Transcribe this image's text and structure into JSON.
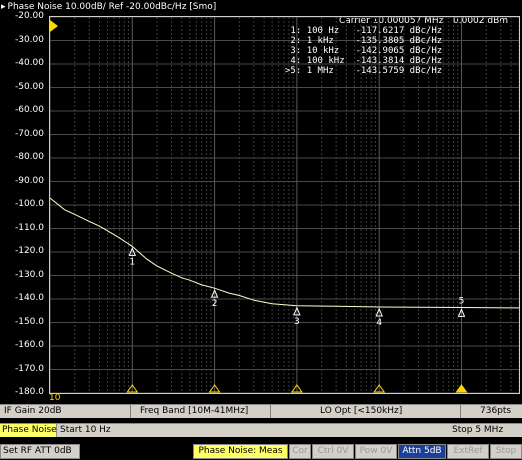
{
  "window_title": "Phase Noise 10.00dB/ Ref -20.00dBc/Hz [Smo]",
  "carrier": {
    "label": "Carrier 10.000057 MHz",
    "power": "0.0002 dBm"
  },
  "markers": [
    {
      "id": "1:",
      "freq": "100 Hz",
      "value": "-117.6217 dBc/Hz"
    },
    {
      "id": "2:",
      "freq": "1 kHz",
      "value": "-135.3805 dBc/Hz"
    },
    {
      "id": "3:",
      "freq": "10 kHz",
      "value": "-142.9065 dBc/Hz"
    },
    {
      "id": "4:",
      "freq": "100 kHz",
      "value": "-143.3814 dBc/Hz"
    },
    {
      "id": ">5:",
      "freq": "1 MHz",
      "value": "-143.5759 dBc/Hz"
    }
  ],
  "y_axis_labels": [
    "-20.00",
    "-30.00",
    "-40.00",
    "-50.00",
    "-60.00",
    "-70.00",
    "-80.00",
    "-90.00",
    "-100.0",
    "-110.0",
    "-120.0",
    "-130.0",
    "-140.0",
    "-150.0",
    "-160.0",
    "-170.0",
    "-180.0"
  ],
  "x_start_label": "10",
  "info_bar": {
    "if_gain": "IF Gain 20dB",
    "freq_band": "Freq Band [10M-41MHz]",
    "lo_opt": "LO Opt [<150kHz]",
    "points": "736pts"
  },
  "sweep_bar": {
    "mode": "Phase Noise",
    "start": "Start 10 Hz",
    "stop": "Stop 5 MHz"
  },
  "softkeys": {
    "set_rf_att": "Set RF ATT 0dB",
    "phase_noise_meas": "Phase Noise: Meas",
    "cor": "Cor",
    "ctrl": "Ctrl 0V",
    "pow": "Pow 0V",
    "attn": "Attn 5dB",
    "extref": "ExtRef",
    "stop": "Stop"
  },
  "chart_data": {
    "type": "line",
    "xscale": "log",
    "xlim": [
      10,
      5000000
    ],
    "ylim": [
      -180,
      -20
    ],
    "ylabel_unit": "dBc/Hz",
    "grid": true,
    "series": [
      {
        "x": [
          10,
          15,
          20,
          30,
          40,
          50,
          70,
          100,
          150,
          200,
          300,
          400,
          500,
          700,
          1000,
          1500,
          2000,
          3000,
          5000,
          10000,
          30000,
          100000,
          300000,
          1000000,
          5000000
        ],
        "y": [
          -97,
          -102,
          -104,
          -107,
          -109,
          -111,
          -114,
          -117.6,
          -123,
          -126,
          -129,
          -131,
          -132,
          -134,
          -135.4,
          -137.5,
          -138.5,
          -140.5,
          -142,
          -142.9,
          -143.1,
          -143.4,
          -143.5,
          -143.6,
          -143.8
        ]
      }
    ],
    "marker_points": [
      {
        "label": "1",
        "x": 100,
        "y": -117.6217
      },
      {
        "label": "2",
        "x": 1000,
        "y": -135.3805
      },
      {
        "label": "3",
        "x": 10000,
        "y": -142.9065
      },
      {
        "label": "4",
        "x": 100000,
        "y": -143.3814
      },
      {
        "label": "5",
        "x": 1000000,
        "y": -143.5759
      }
    ]
  }
}
